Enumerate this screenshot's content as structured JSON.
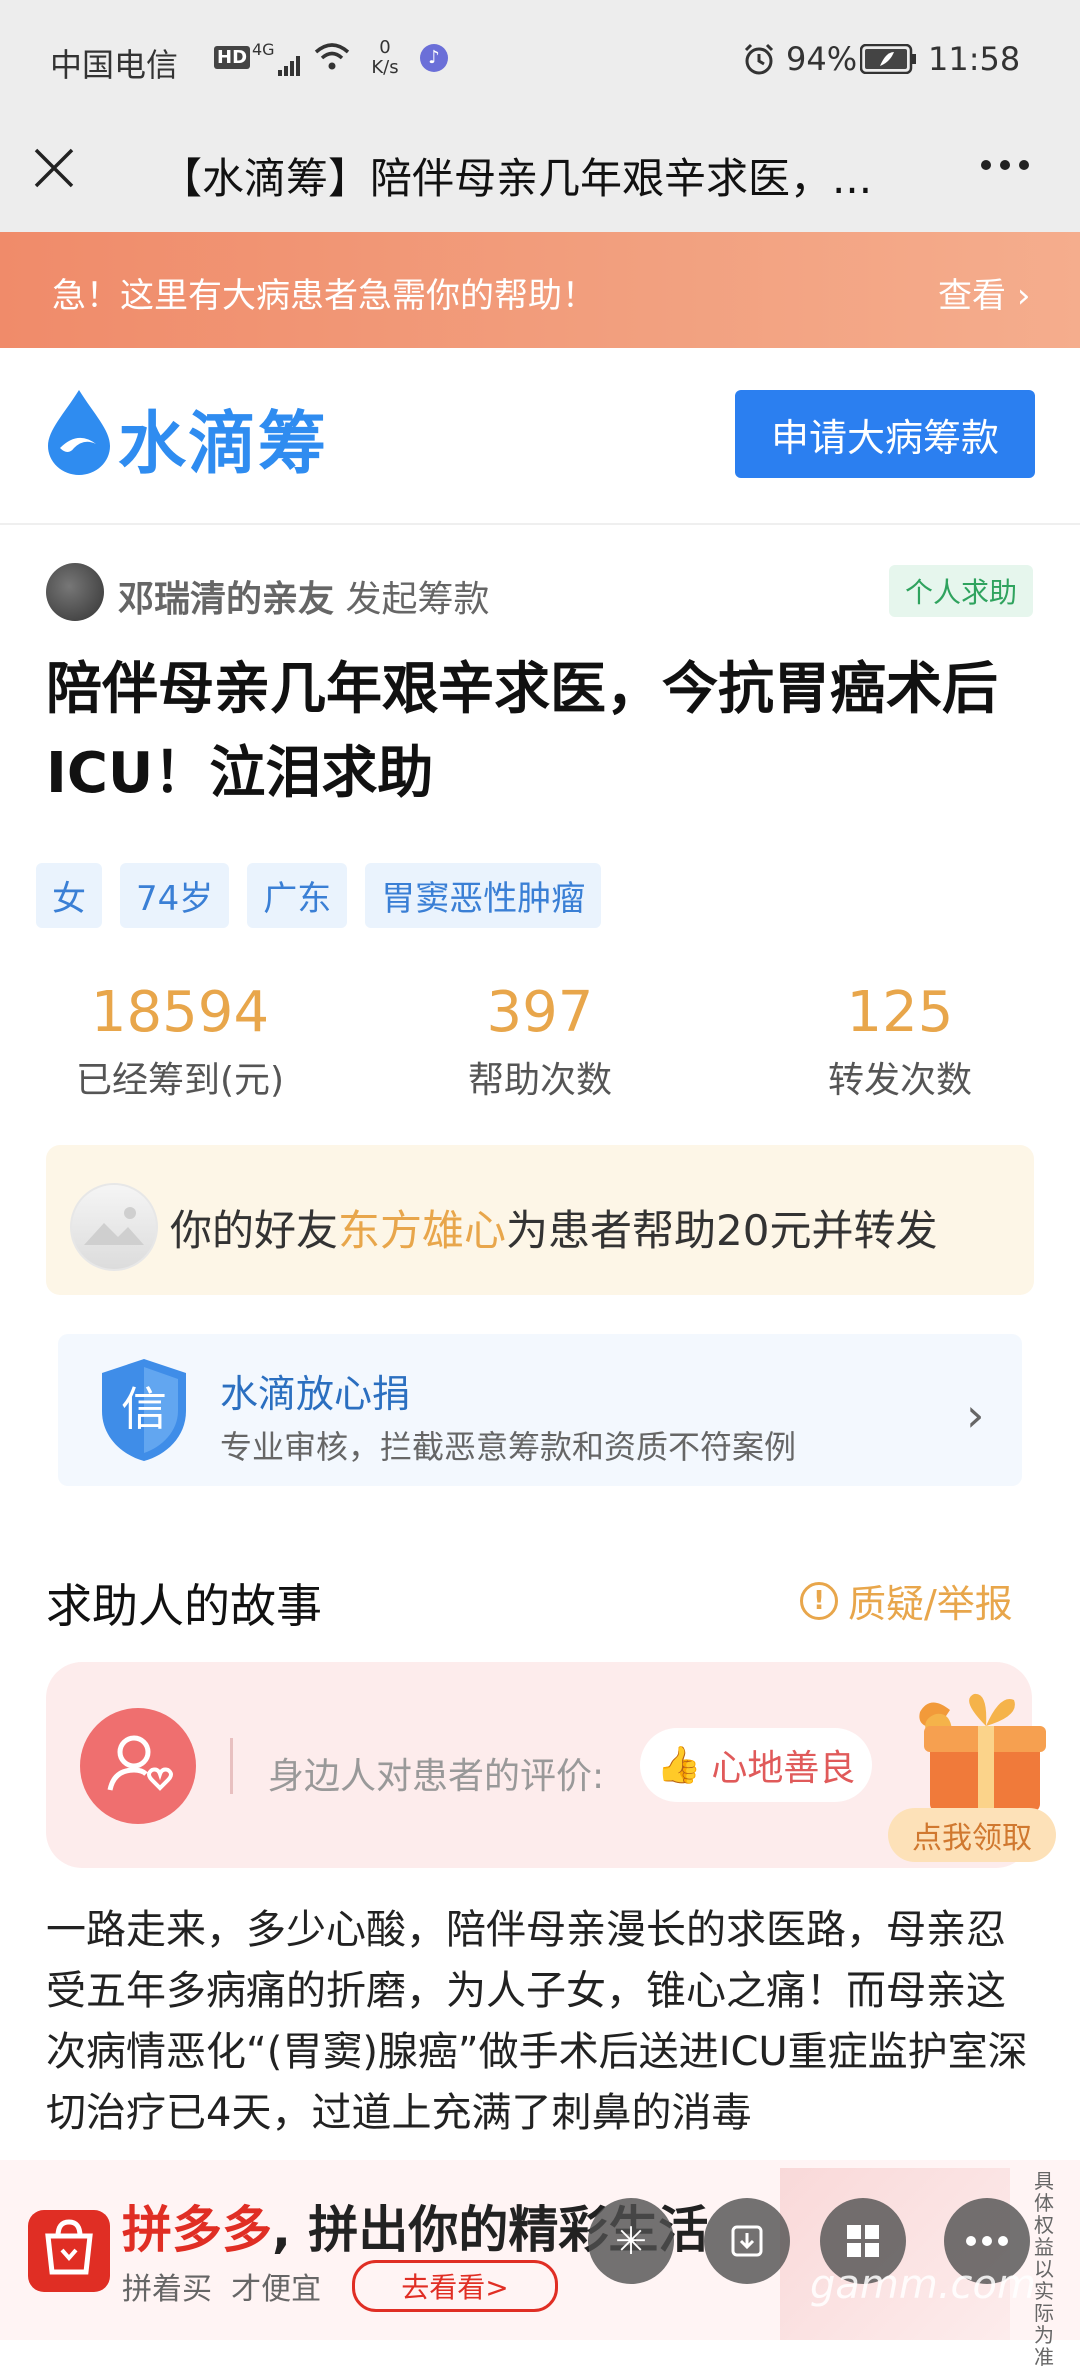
{
  "status": {
    "carrier": "中国电信",
    "hd": "HD",
    "net": "4G",
    "speed_val": "0",
    "speed_unit": "K/s",
    "battery": "94%",
    "time": "11:58"
  },
  "nav": {
    "title": "【水滴筹】陪伴母亲几年艰辛求医，..."
  },
  "banner": {
    "text": "急！这里有大病患者急需你的帮助！",
    "link": "查看"
  },
  "brand": {
    "name": "水滴筹",
    "apply": "申请大病筹款"
  },
  "initiator": {
    "name": "邓瑞清的亲友",
    "action": "发起筹款",
    "tag": "个人求助"
  },
  "campaign": {
    "title": "陪伴母亲几年艰辛求医，今抗胃癌术后ICU！泣泪求助",
    "tags": [
      "女",
      "74岁",
      "广东",
      "胃窦恶性肿瘤"
    ]
  },
  "stats": [
    {
      "value": "18594",
      "label": "已经筹到(元)"
    },
    {
      "value": "397",
      "label": "帮助次数"
    },
    {
      "value": "125",
      "label": "转发次数"
    }
  ],
  "friend": {
    "prefix": "你的好友",
    "name": "东方雄心",
    "suffix": "为患者帮助20元并转发"
  },
  "safe": {
    "title": "水滴放心捐",
    "sub": "专业审核，拦截恶意筹款和资质不符案例",
    "icon_char": "信"
  },
  "story": {
    "heading": "求助人的故事",
    "report": "质疑/举报",
    "eval_label": "身边人对患者的评价:",
    "eval_tag": "心地善良",
    "claim": "点我领取",
    "text": "一路走来，多少心酸，陪伴母亲漫长的求医路，母亲忍受五年多病痛的折磨，为人子女，锥心之痛！而母亲这次病情恶化“(胃窦)腺癌”做手术后送进ICU重症监护室深切治疗已4天，过道上充满了刺鼻的消毒"
  },
  "ad": {
    "title_brand": "拼多多",
    "title_rest": ", 拼出你的精彩生活",
    "sub1": "拼着买",
    "sub2": "才便宜",
    "btn": "去看看>",
    "note": "具体权益以实际为准"
  },
  "watermark": "gamm.com",
  "colors": {
    "accent": "#2b7ff0",
    "orange": "#e8a64b",
    "red": "#e02e24"
  }
}
